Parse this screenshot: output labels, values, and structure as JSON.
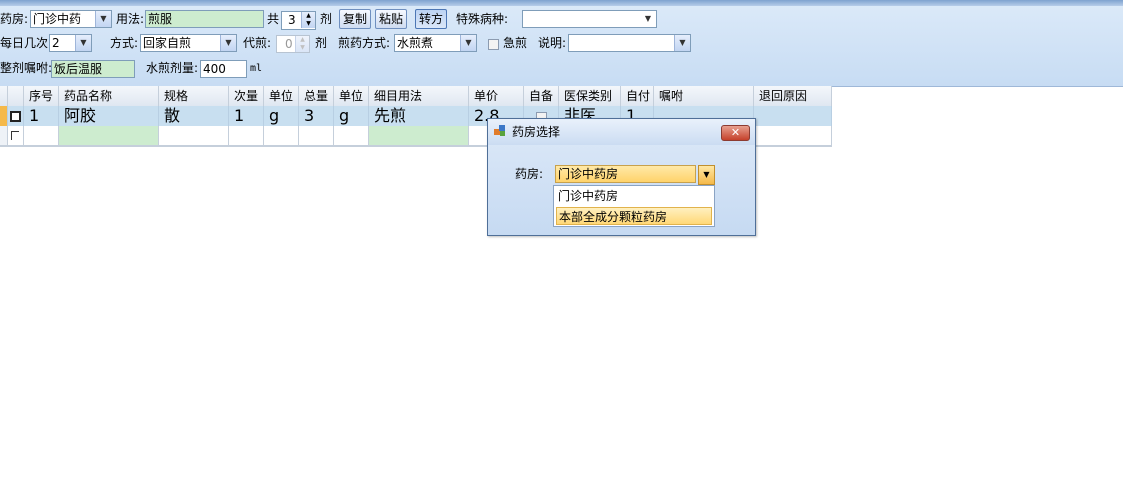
{
  "toolbar": {
    "pharmacy_label": "药房:",
    "pharmacy_value": "门诊中药",
    "usage_label": "用法:",
    "usage_value": "煎服",
    "total_label": "共",
    "doses_value": "3",
    "dose_unit": "剂",
    "copy_button": "复制",
    "paste_button": "粘贴",
    "convert_button": "转方",
    "special_disease_label": "特殊病种:",
    "special_disease_value": "",
    "daily_times_label": "每日几次:",
    "daily_times_value": "2",
    "method_label": "方式:",
    "method_value": "回家自煎",
    "decoct_label": "代煎:",
    "decoct_value": "0",
    "decoct_unit": "剂",
    "decoct_method_label": "煎药方式:",
    "decoct_method_value": "水煎煮",
    "urgent_label": "急煎",
    "note_label": "说明:",
    "note_value": "",
    "instruction_label": "整剂嘱咐:",
    "instruction_value": "饭后温服",
    "water_label": "水煎剂量:",
    "water_value": "400",
    "water_unit": "ml"
  },
  "grid": {
    "headers": [
      "序号",
      "药品名称",
      "规格",
      "次量",
      "单位",
      "总量",
      "单位",
      "细目用法",
      "单价",
      "自备",
      "医保类别",
      "自付",
      "嘱咐",
      "退回原因"
    ],
    "row1": [
      "1",
      "阿胶",
      "散",
      "1",
      "g",
      "3",
      "g",
      "先煎",
      "2.8",
      "",
      "非医",
      "1",
      "",
      ""
    ]
  },
  "dialog": {
    "title": "药房选择",
    "pharmacy_label": "药房:",
    "selected": "门诊中药房",
    "options": [
      "门诊中药房",
      "本部全成分颗粒药房"
    ],
    "close_symbol": "✕"
  },
  "icons": {
    "dialog_icon": "app-icon",
    "dropdown": "chevron-down-icon"
  }
}
